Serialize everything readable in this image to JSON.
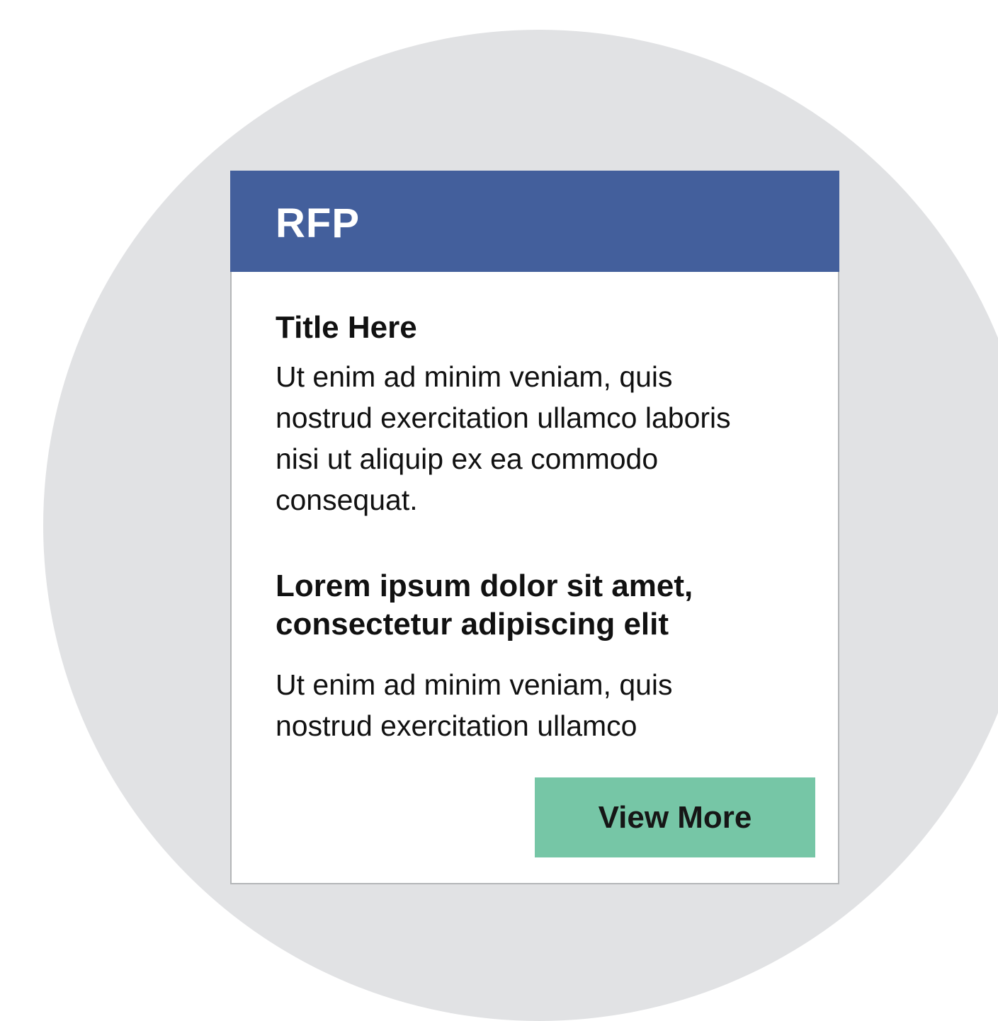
{
  "card": {
    "header_title": "RFP",
    "sections": [
      {
        "title": "Title Here",
        "body": "Ut enim ad minim veniam, quis nostrud exercitation ullamco laboris nisi ut aliquip ex ea commodo consequat."
      },
      {
        "title": "Lorem ipsum dolor sit amet, consectetur adipiscing elit",
        "body": "Ut enim ad minim veniam, quis nostrud exercitation ullamco"
      }
    ],
    "button_label": "View More"
  },
  "colors": {
    "background_circle": "#e1e2e4",
    "header": "#435f9c",
    "button": "#76c6a6",
    "card_border": "#b4b6b8"
  }
}
